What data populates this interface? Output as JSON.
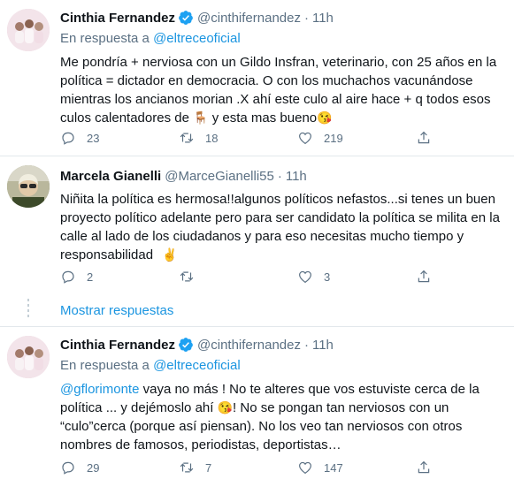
{
  "tweets": [
    {
      "name": "Cinthia Fernandez",
      "handle": "@cinthifernandez",
      "time": "11h",
      "reply_prefix": "En respuesta a",
      "reply_to": "@eltreceoficial",
      "text_before": "Me pondría + nerviosa con un Gildo Insfran, veterinario, con 25 años en la política = dictador en democracia. O con los muchachos vacunándose mientras los ancianos morian .X ahí este culo al aire hace + q todos esos culos calentadores de",
      "emoji1": "🪑",
      "text_mid": "y esta mas bueno",
      "emoji2": "😘",
      "replies": "23",
      "retweets": "18",
      "likes": "219"
    },
    {
      "name": "Marcela Gianelli",
      "handle": "@MarceGianelli55",
      "time": "11h",
      "text_before": "Niñita la política es hermosa!!algunos políticos nefastos...si tenes un buen proyecto político adelante pero para ser candidato la política se milita en la calle al lado de los ciudadanos y para eso necesitas mucho tiempo y responsabilidad",
      "emoji1": "✌️",
      "replies": "2",
      "retweets": "",
      "likes": "3"
    },
    {
      "name": "Cinthia Fernandez",
      "handle": "@cinthifernandez",
      "time": "11h",
      "reply_prefix": "En respuesta a",
      "reply_to": "@eltreceoficial",
      "mention": "@gflorimonte",
      "text_before": "vaya no más ! No te alteres que vos estuviste cerca de la política ... y dejémoslo ahí",
      "emoji1": "😘",
      "text_mid": "! No se pongan tan nerviosos con un “culo”cerca (porque así piensan). No los veo tan nerviosos con otros nombres de famosos, periodistas, deportistas…",
      "replies": "29",
      "retweets": "7",
      "likes": "147"
    }
  ],
  "show_replies": "Mostrar respuestas",
  "colors": {
    "accent": "#1b95e0",
    "muted": "#5b7083",
    "verified": "#1da1f2",
    "divider": "#e3e8ec"
  },
  "icons": [
    "verified-badge-icon",
    "reply-icon",
    "retweet-icon",
    "like-icon",
    "share-icon"
  ]
}
